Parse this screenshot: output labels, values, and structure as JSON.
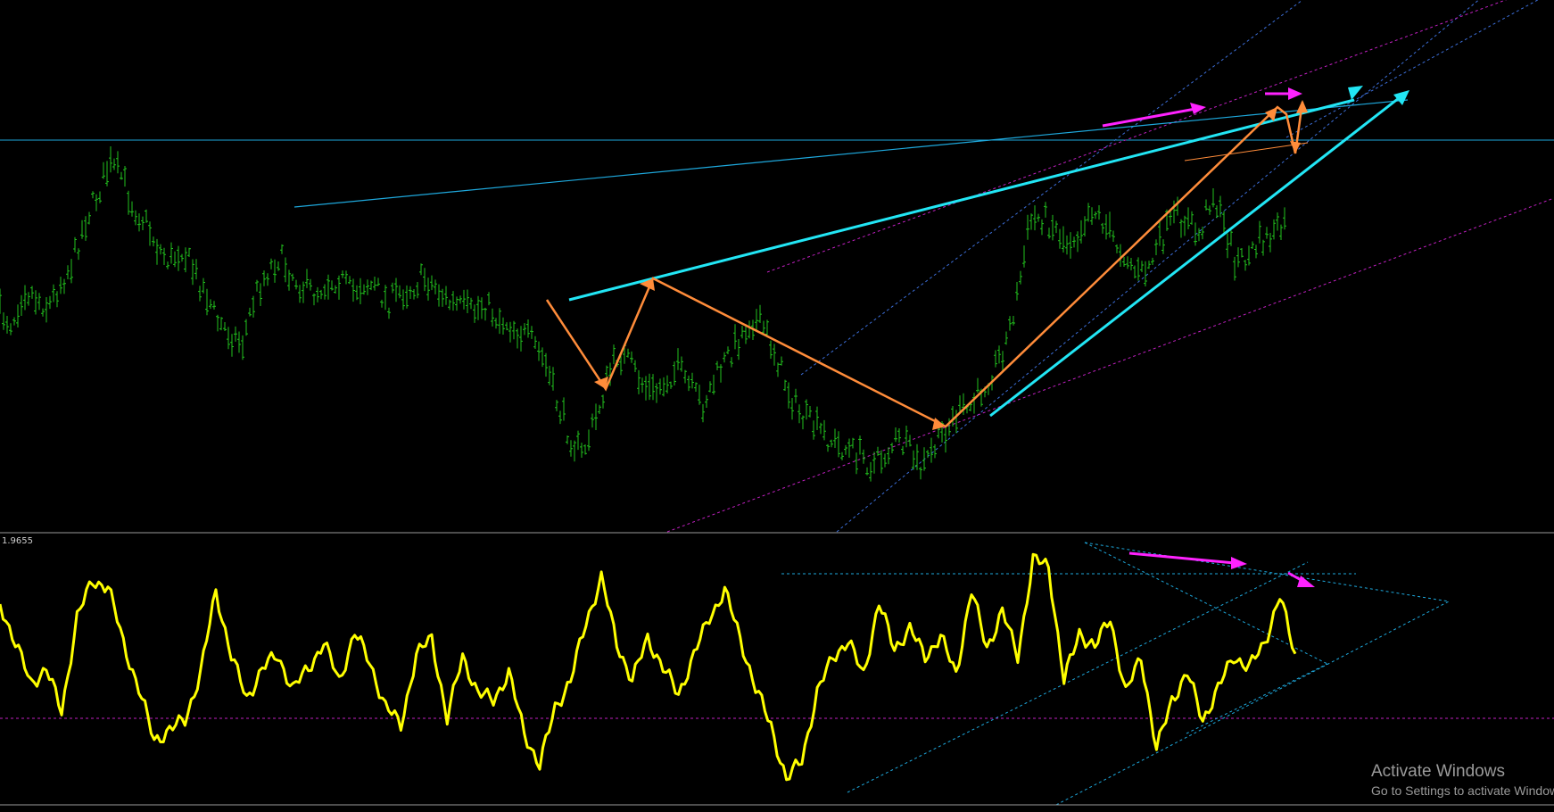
{
  "indicator": {
    "label": "1.9655"
  },
  "watermark": {
    "title": "Activate Windows",
    "subtitle": "Go to Settings to activate Windows."
  },
  "colors": {
    "background": "#000000",
    "price_bars": "#22c21e",
    "oscillator": "#ffff00",
    "wave_arrows": "#ff8c3a",
    "trend_lines": "#22e6f5",
    "thin_trend": "#1ea8dc",
    "divergence_arrows": "#ff22ff",
    "magenta_channel": "#c020c0",
    "blue_channel": "#3c6ed8",
    "separator": "#9a9a9a",
    "zero_line": "#c020c0",
    "horizontal_level": "#1ea8dc"
  },
  "chart_data": [
    {
      "type": "line",
      "title": "",
      "series": [
        {
          "values": [
            0.42,
            0.4,
            0.47,
            0.45,
            0.43,
            0.48,
            0.52,
            0.6,
            0.65,
            0.71,
            0.69,
            0.63,
            0.6,
            0.55,
            0.52,
            0.55,
            0.5,
            0.46,
            0.4,
            0.38,
            0.36,
            0.45,
            0.5,
            0.53,
            0.5,
            0.47,
            0.46,
            0.48,
            0.49,
            0.46,
            0.48,
            0.47,
            0.44,
            0.46,
            0.47,
            0.49,
            0.47,
            0.44,
            0.43,
            0.42,
            0.44,
            0.41,
            0.4,
            0.38,
            0.36,
            0.32,
            0.24,
            0.18,
            0.14,
            0.2,
            0.28,
            0.34,
            0.32,
            0.28,
            0.26,
            0.29,
            0.31,
            0.27,
            0.24,
            0.29,
            0.33,
            0.37,
            0.41,
            0.39,
            0.34,
            0.27,
            0.22,
            0.2,
            0.18,
            0.16,
            0.15,
            0.14,
            0.12,
            0.14,
            0.17,
            0.15,
            0.11,
            0.15,
            0.19,
            0.22,
            0.23,
            0.27,
            0.31,
            0.36,
            0.46,
            0.6,
            0.61,
            0.59,
            0.56,
            0.58,
            0.63,
            0.6,
            0.56,
            0.53,
            0.49,
            0.52,
            0.57,
            0.61,
            0.6,
            0.57,
            0.66,
            0.59,
            0.52,
            0.53,
            0.56,
            0.57,
            0.59
          ]
        }
      ]
    },
    {
      "type": "line",
      "title": "",
      "series": [
        {
          "values": [
            75,
            60,
            44,
            50,
            33,
            70,
            84,
            82,
            60,
            42,
            22,
            26,
            30,
            48,
            80,
            55,
            38,
            50,
            55,
            42,
            50,
            60,
            45,
            64,
            52,
            35,
            28,
            55,
            62,
            30,
            55,
            40,
            38,
            48,
            25,
            12,
            35,
            45,
            68,
            85,
            60,
            45,
            62,
            50,
            40,
            55,
            70,
            80,
            62,
            42,
            28,
            6,
            15,
            40,
            55,
            60,
            48,
            75,
            58,
            65,
            55,
            62,
            48,
            80,
            58,
            72,
            55,
            92,
            90,
            45,
            64,
            58,
            70,
            40,
            55,
            18,
            38,
            48,
            30,
            42,
            55,
            50,
            60,
            78,
            55
          ]
        }
      ]
    }
  ]
}
